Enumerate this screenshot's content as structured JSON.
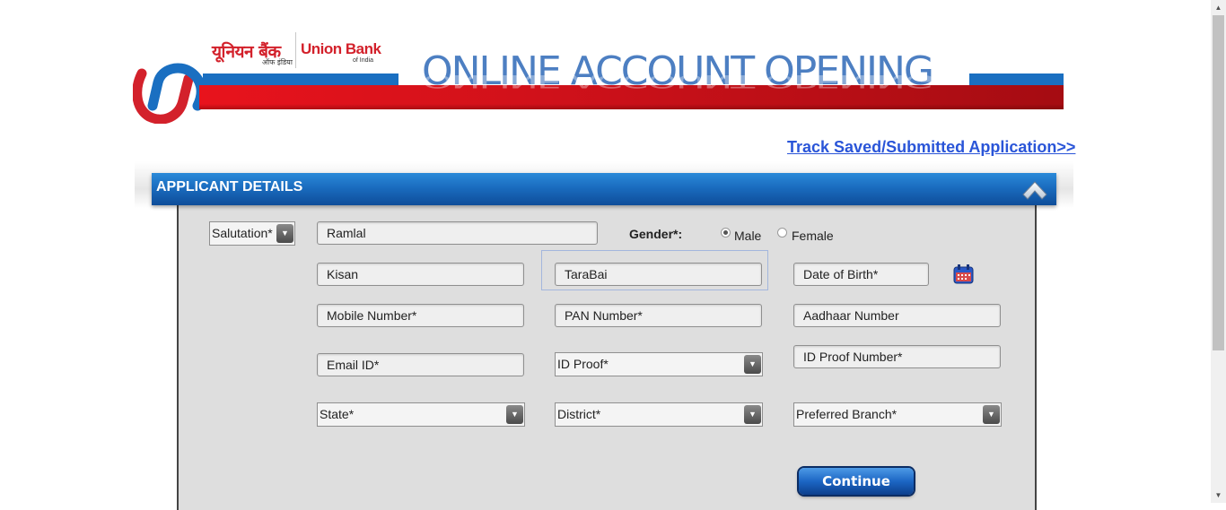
{
  "header": {
    "brand_hindi": "यूनियन बैंक",
    "brand_hindi_tagline": "ऑफ इंडिया",
    "brand_english": "Union Bank",
    "brand_english_tagline": "of India",
    "banner_title": "ONLINE ACCOUNT OPENING"
  },
  "track_link": "Track Saved/Submitted Application>>",
  "panel": {
    "title": "APPLICANT DETAILS"
  },
  "form": {
    "salutation": "Salutation*",
    "first_name": "Ramlal",
    "gender_label": "Gender*:",
    "gender_options": [
      "Male",
      "Female"
    ],
    "gender_selected": "Male",
    "father_name": "Kisan",
    "mother_name": "TaraBai",
    "dob_placeholder": "Date of Birth*",
    "mobile_placeholder": "Mobile Number*",
    "pan_placeholder": "PAN Number*",
    "aadhaar_placeholder": "Aadhaar Number",
    "email_placeholder": "Email ID*",
    "id_proof": "ID Proof*",
    "id_proof_number_placeholder": "ID Proof Number*",
    "state": "State*",
    "district": "District*",
    "preferred_branch": "Preferred Branch*",
    "continue_label": "Continue"
  },
  "icons": {
    "collapse": "chevron-up-icon",
    "calendar": "calendar-icon",
    "select_arrow": "triangle-down-icon"
  },
  "colors": {
    "brand_red": "#d3212b",
    "brand_blue": "#1a6fc1",
    "header_blue": "#1a6cbf",
    "link_blue": "#2a55d8"
  }
}
